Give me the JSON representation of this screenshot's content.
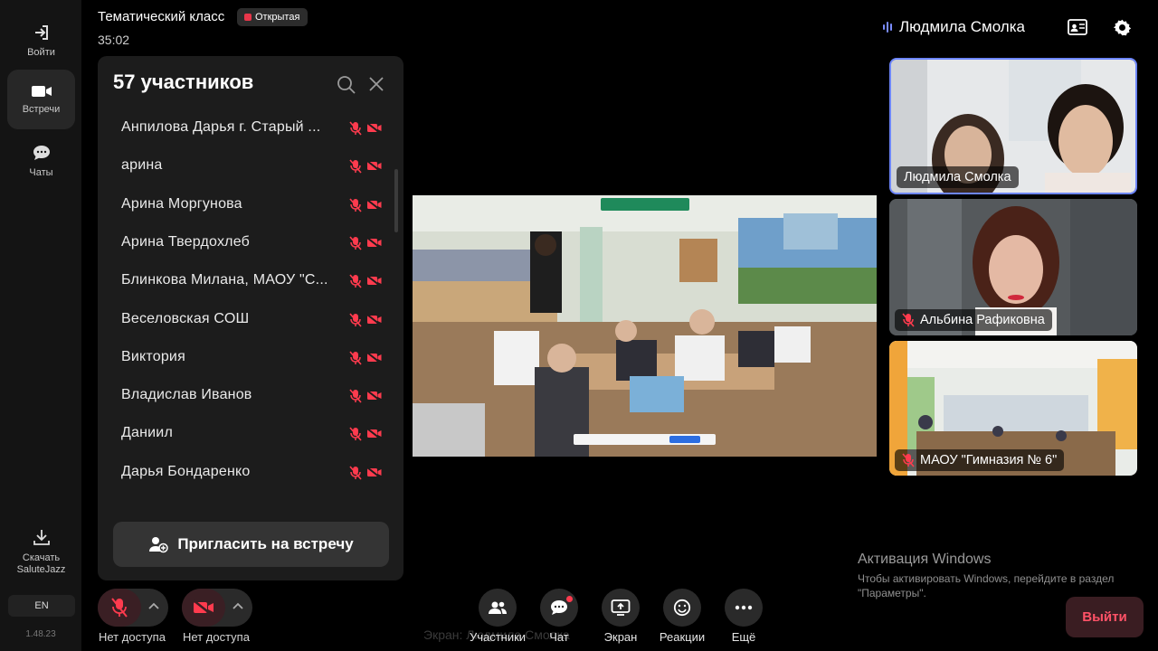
{
  "rail": {
    "items": [
      {
        "label": "Войти",
        "icon": "login-icon"
      },
      {
        "label": "Встречи",
        "icon": "video-camera-icon"
      },
      {
        "label": "Чаты",
        "icon": "chat-bubble-icon"
      }
    ],
    "download_label": "Скачать SaluteJazz",
    "language": "EN",
    "version": "1.48.23"
  },
  "header": {
    "title": "Тематический класс",
    "status_badge": "Открытая",
    "timer": "35:02"
  },
  "participants": {
    "title": "57 участников",
    "list": [
      {
        "name": "Анпилова Дарья г. Старый ..."
      },
      {
        "name": "арина"
      },
      {
        "name": "Арина Моргунова"
      },
      {
        "name": "Арина Твердохлеб"
      },
      {
        "name": "Блинкова Милана, МАОУ \"С..."
      },
      {
        "name": "Веселовская СОШ"
      },
      {
        "name": "Виктория"
      },
      {
        "name": "Владислав Иванов"
      },
      {
        "name": "Даниил"
      },
      {
        "name": "Дарья Бондаренко"
      }
    ],
    "invite_label": "Пригласить на встречу"
  },
  "stage": {
    "screen_label": "Экран: Людмила Смолка"
  },
  "speaker": {
    "name": "Людмила Смолка"
  },
  "tiles": [
    {
      "name": "Людмила Смолка",
      "muted": false
    },
    {
      "name": "Альбина Рафиковна",
      "muted": true
    },
    {
      "name": "МАОУ \"Гимназия № 6\"",
      "muted": true
    }
  ],
  "watermark": {
    "title": "Активация Windows",
    "text": "Чтобы активировать Windows, перейдите в раздел \"Параметры\"."
  },
  "controls": {
    "mic_label": "Нет доступа",
    "cam_label": "Нет доступа",
    "tools": [
      {
        "label": "Участники",
        "icon": "participants-icon"
      },
      {
        "label": "Чат",
        "icon": "chat-icon"
      },
      {
        "label": "Экран",
        "icon": "screen-share-icon"
      },
      {
        "label": "Реакции",
        "icon": "smile-icon"
      },
      {
        "label": "Ещё",
        "icon": "more-icon"
      }
    ],
    "leave_label": "Выйти"
  },
  "colors": {
    "accent": "#6d86ff",
    "danger": "#ff3b4e",
    "leave_text": "#ff5267",
    "background": "#000000",
    "panel": "#1c1c1c"
  }
}
